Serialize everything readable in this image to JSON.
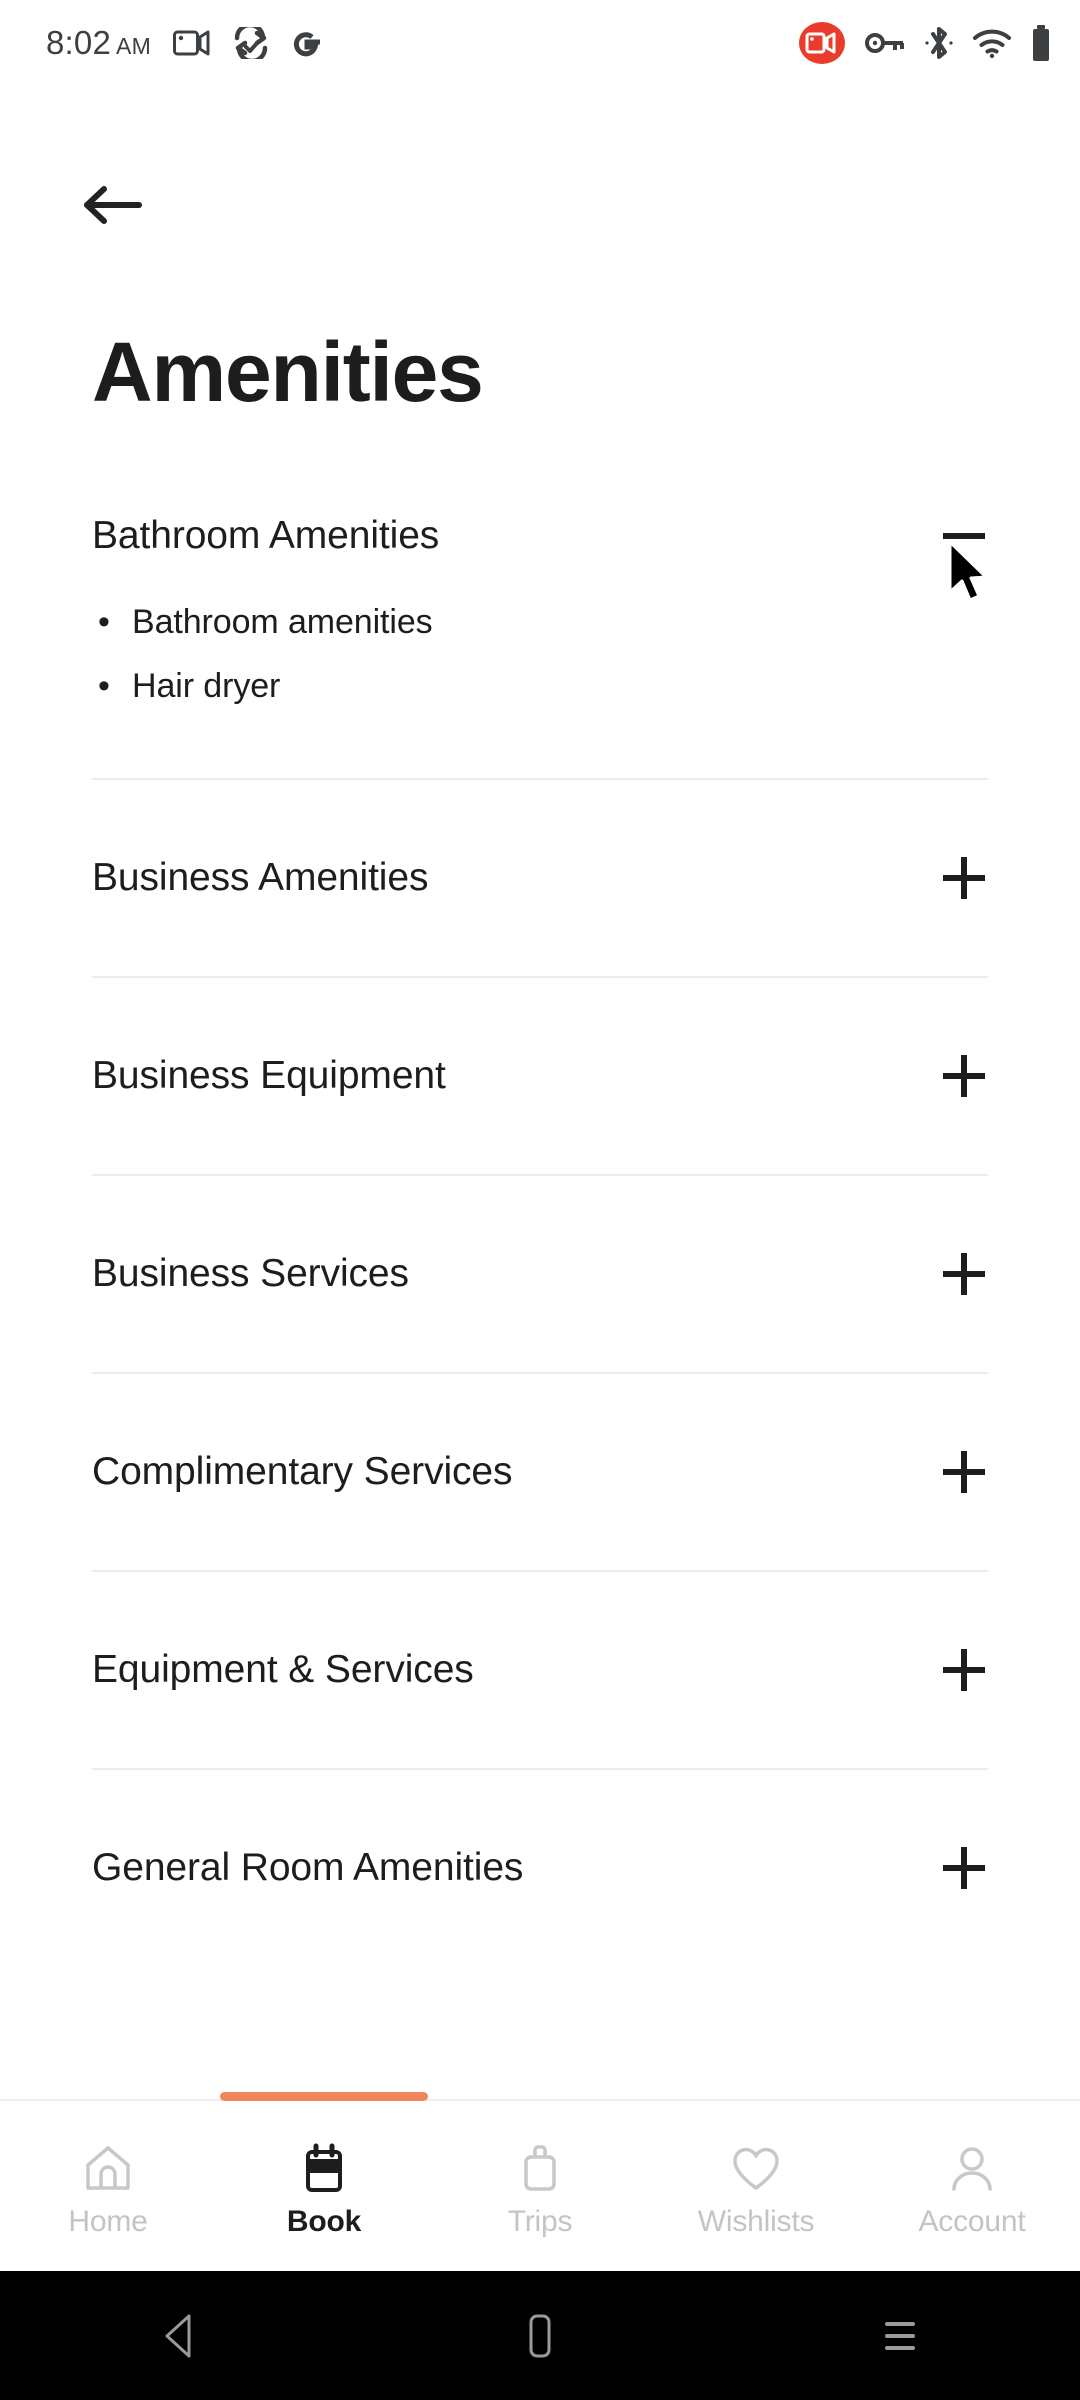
{
  "status_bar": {
    "time": "8:02",
    "meridiem": "AM",
    "left_icons": [
      "screen-record-icon",
      "sync-pen-icon",
      "google-g-icon"
    ],
    "right_icons": [
      "recording-active-icon",
      "vpn-key-icon",
      "bluetooth-icon",
      "wifi-icon",
      "battery-icon"
    ],
    "recording_badge_color": "#ea3c2d"
  },
  "header": {
    "back_label": "back-arrow",
    "title": "Amenities"
  },
  "sections": [
    {
      "title": "Bathroom Amenities",
      "expanded": true,
      "toggle": "minus",
      "items": [
        "Bathroom amenities",
        "Hair dryer"
      ]
    },
    {
      "title": "Business Amenities",
      "expanded": false,
      "toggle": "plus",
      "items": []
    },
    {
      "title": "Business Equipment",
      "expanded": false,
      "toggle": "plus",
      "items": []
    },
    {
      "title": "Business Services",
      "expanded": false,
      "toggle": "plus",
      "items": []
    },
    {
      "title": "Complimentary Services",
      "expanded": false,
      "toggle": "plus",
      "items": []
    },
    {
      "title": "Equipment & Services",
      "expanded": false,
      "toggle": "plus",
      "items": []
    },
    {
      "title": "General Room Amenities",
      "expanded": false,
      "toggle": "plus",
      "items": []
    }
  ],
  "bullet_glyph": "•",
  "bottom_nav": {
    "active_index": 1,
    "indicator_color": "#f2855a",
    "items": [
      {
        "label": "Home",
        "icon": "home-icon"
      },
      {
        "label": "Book",
        "icon": "calendar-icon"
      },
      {
        "label": "Trips",
        "icon": "suitcase-icon"
      },
      {
        "label": "Wishlists",
        "icon": "heart-icon"
      },
      {
        "label": "Account",
        "icon": "person-icon"
      }
    ]
  },
  "android_nav": {
    "buttons": [
      {
        "name": "back-nav-icon"
      },
      {
        "name": "home-nav-icon"
      },
      {
        "name": "recents-nav-icon"
      }
    ]
  }
}
